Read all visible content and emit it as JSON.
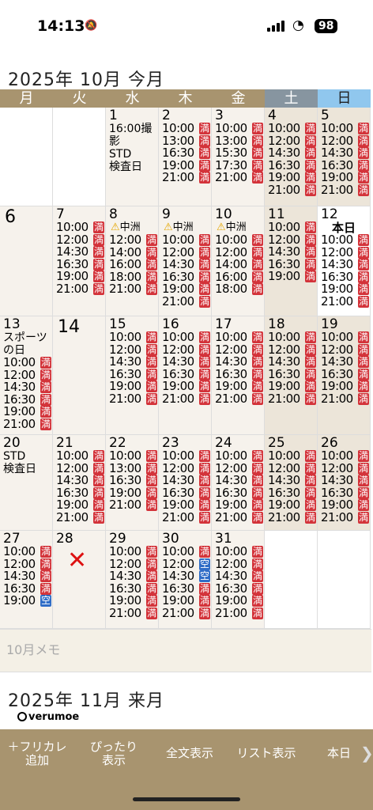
{
  "status": {
    "time": "14:13",
    "battery": "98"
  },
  "calendar": {
    "title": "2025年 10月 今月",
    "weekdays": [
      "月",
      "火",
      "水",
      "木",
      "金",
      "土",
      "日"
    ],
    "today_label": "本日",
    "full": "満",
    "empty": "空",
    "memo_placeholder": "10月メモ",
    "next_title": "2025年 11月 来月",
    "weeks": [
      [
        {
          "type": "empty"
        },
        {
          "type": "empty"
        },
        {
          "day": "1",
          "notes": [
            "16:00撮",
            "影",
            "STD",
            "検査日"
          ],
          "slots": []
        },
        {
          "day": "2",
          "slots": [
            [
              "10:00",
              "満"
            ],
            [
              "13:00",
              "満"
            ],
            [
              "16:30",
              "満"
            ],
            [
              "19:00",
              "満"
            ],
            [
              "21:00",
              "満"
            ]
          ]
        },
        {
          "day": "3",
          "slots": [
            [
              "10:00",
              "満"
            ],
            [
              "13:00",
              "満"
            ],
            [
              "15:30",
              "満"
            ],
            [
              "17:30",
              "満"
            ],
            [
              "21:00",
              "満"
            ]
          ]
        },
        {
          "day": "4",
          "wk": true,
          "slots": [
            [
              "10:00",
              "満"
            ],
            [
              "12:00",
              "満"
            ],
            [
              "14:30",
              "満"
            ],
            [
              "16:30",
              "満"
            ],
            [
              "19:00",
              "満"
            ],
            [
              "21:00",
              "満"
            ]
          ]
        },
        {
          "day": "5",
          "wk": true,
          "slots": [
            [
              "10:00",
              "満"
            ],
            [
              "12:00",
              "満"
            ],
            [
              "14:30",
              "満"
            ],
            [
              "16:30",
              "満"
            ],
            [
              "19:00",
              "満"
            ],
            [
              "21:00",
              "満"
            ]
          ]
        }
      ],
      [
        {
          "day": "6",
          "big": true,
          "slots": []
        },
        {
          "day": "7",
          "slots": [
            [
              "10:00",
              "満"
            ],
            [
              "12:00",
              "満"
            ],
            [
              "14:30",
              "満"
            ],
            [
              "16:30",
              "満"
            ],
            [
              "19:00",
              "満"
            ],
            [
              "21:00",
              "満"
            ]
          ]
        },
        {
          "day": "8",
          "warn": "中洲",
          "slots": [
            [
              "12:00",
              "満"
            ],
            [
              "14:00",
              "満"
            ],
            [
              "16:00",
              "満"
            ],
            [
              "18:00",
              "満"
            ],
            [
              "21:00",
              "満"
            ]
          ]
        },
        {
          "day": "9",
          "warn": "中洲",
          "slots": [
            [
              "10:00",
              "満"
            ],
            [
              "12:00",
              "満"
            ],
            [
              "14:30",
              "満"
            ],
            [
              "16:30",
              "満"
            ],
            [
              "19:00",
              "満"
            ],
            [
              "21:00",
              "満"
            ]
          ]
        },
        {
          "day": "10",
          "warn": "中洲",
          "slots": [
            [
              "10:00",
              "満"
            ],
            [
              "12:00",
              "満"
            ],
            [
              "14:00",
              "満"
            ],
            [
              "16:00",
              "満"
            ],
            [
              "18:00",
              "満"
            ]
          ]
        },
        {
          "day": "11",
          "wk": true,
          "slots": [
            [
              "10:00",
              "満"
            ],
            [
              "12:00",
              "満"
            ],
            [
              "14:30",
              "満"
            ],
            [
              "16:30",
              "満"
            ],
            [
              "19:00",
              "満"
            ]
          ]
        },
        {
          "day": "12",
          "today": true,
          "slots": [
            [
              "10:00",
              "満"
            ],
            [
              "12:00",
              "満"
            ],
            [
              "14:30",
              "満"
            ],
            [
              "16:30",
              "満"
            ],
            [
              "19:00",
              "満"
            ],
            [
              "21:00",
              "満"
            ]
          ]
        }
      ],
      [
        {
          "day": "13",
          "notes": [
            "スポーツ",
            "の日"
          ],
          "slots": [
            [
              "10:00",
              "満"
            ],
            [
              "12:00",
              "満"
            ],
            [
              "14:30",
              "満"
            ],
            [
              "16:30",
              "満"
            ],
            [
              "19:00",
              "満"
            ],
            [
              "21:00",
              "満"
            ]
          ]
        },
        {
          "day": "14",
          "big": true,
          "slots": []
        },
        {
          "day": "15",
          "slots": [
            [
              "10:00",
              "満"
            ],
            [
              "12:00",
              "満"
            ],
            [
              "14:30",
              "満"
            ],
            [
              "16:30",
              "満"
            ],
            [
              "19:00",
              "満"
            ],
            [
              "21:00",
              "満"
            ]
          ]
        },
        {
          "day": "16",
          "slots": [
            [
              "10:00",
              "満"
            ],
            [
              "12:00",
              "満"
            ],
            [
              "14:30",
              "満"
            ],
            [
              "16:30",
              "満"
            ],
            [
              "19:00",
              "満"
            ],
            [
              "21:00",
              "満"
            ]
          ]
        },
        {
          "day": "17",
          "slots": [
            [
              "10:00",
              "満"
            ],
            [
              "12:00",
              "満"
            ],
            [
              "14:30",
              "満"
            ],
            [
              "16:30",
              "満"
            ],
            [
              "19:00",
              "満"
            ],
            [
              "21:00",
              "満"
            ]
          ]
        },
        {
          "day": "18",
          "wk": true,
          "slots": [
            [
              "10:00",
              "満"
            ],
            [
              "12:00",
              "満"
            ],
            [
              "14:30",
              "満"
            ],
            [
              "16:30",
              "満"
            ],
            [
              "19:00",
              "満"
            ],
            [
              "21:00",
              "満"
            ]
          ]
        },
        {
          "day": "19",
          "wk": true,
          "slots": [
            [
              "10:00",
              "満"
            ],
            [
              "12:00",
              "満"
            ],
            [
              "14:30",
              "満"
            ],
            [
              "16:30",
              "満"
            ],
            [
              "19:00",
              "満"
            ],
            [
              "21:00",
              "満"
            ]
          ]
        }
      ],
      [
        {
          "day": "20",
          "notes": [
            "STD",
            "検査日"
          ],
          "slots": []
        },
        {
          "day": "21",
          "slots": [
            [
              "10:00",
              "満"
            ],
            [
              "12:00",
              "満"
            ],
            [
              "14:30",
              "満"
            ],
            [
              "16:30",
              "満"
            ],
            [
              "19:00",
              "満"
            ],
            [
              "21:00",
              "満"
            ]
          ]
        },
        {
          "day": "22",
          "slots": [
            [
              "10:00",
              "満"
            ],
            [
              "13:00",
              "満"
            ],
            [
              "16:30",
              "満"
            ],
            [
              "19:00",
              "満"
            ],
            [
              "21:00",
              "満"
            ]
          ]
        },
        {
          "day": "23",
          "slots": [
            [
              "10:00",
              "満"
            ],
            [
              "12:00",
              "満"
            ],
            [
              "14:30",
              "満"
            ],
            [
              "16:30",
              "満"
            ],
            [
              "19:00",
              "満"
            ],
            [
              "21:00",
              "満"
            ]
          ]
        },
        {
          "day": "24",
          "slots": [
            [
              "10:00",
              "満"
            ],
            [
              "12:00",
              "満"
            ],
            [
              "14:30",
              "満"
            ],
            [
              "16:30",
              "満"
            ],
            [
              "19:00",
              "満"
            ],
            [
              "21:00",
              "満"
            ]
          ]
        },
        {
          "day": "25",
          "wk": true,
          "slots": [
            [
              "10:00",
              "満"
            ],
            [
              "12:00",
              "満"
            ],
            [
              "14:30",
              "満"
            ],
            [
              "16:30",
              "満"
            ],
            [
              "19:00",
              "満"
            ],
            [
              "21:00",
              "満"
            ]
          ]
        },
        {
          "day": "26",
          "wk": true,
          "slots": [
            [
              "10:00",
              "満"
            ],
            [
              "12:00",
              "満"
            ],
            [
              "14:30",
              "満"
            ],
            [
              "16:30",
              "満"
            ],
            [
              "19:00",
              "満"
            ],
            [
              "21:00",
              "満"
            ]
          ]
        }
      ],
      [
        {
          "day": "27",
          "slots": [
            [
              "10:00",
              "満"
            ],
            [
              "12:00",
              "満"
            ],
            [
              "14:30",
              "満"
            ],
            [
              "16:30",
              "満"
            ],
            [
              "19:00",
              "空"
            ]
          ]
        },
        {
          "day": "28",
          "closed": true,
          "slots": []
        },
        {
          "day": "29",
          "slots": [
            [
              "10:00",
              "満"
            ],
            [
              "12:00",
              "満"
            ],
            [
              "14:30",
              "満"
            ],
            [
              "16:30",
              "満"
            ],
            [
              "19:00",
              "満"
            ],
            [
              "21:00",
              "満"
            ]
          ]
        },
        {
          "day": "30",
          "slots": [
            [
              "10:00",
              "満"
            ],
            [
              "12:00",
              "空"
            ],
            [
              "14:30",
              "空"
            ],
            [
              "16:30",
              "満"
            ],
            [
              "19:00",
              "満"
            ],
            [
              "21:00",
              "満"
            ]
          ]
        },
        {
          "day": "31",
          "slots": [
            [
              "10:00",
              "満"
            ],
            [
              "12:00",
              "満"
            ],
            [
              "14:30",
              "満"
            ],
            [
              "16:30",
              "満"
            ],
            [
              "19:00",
              "満"
            ],
            [
              "21:00",
              "満"
            ]
          ]
        },
        {
          "type": "empty"
        },
        {
          "type": "empty"
        }
      ]
    ]
  },
  "logo": "verumoe",
  "toolbar": {
    "add_line1": "＋フリカレ",
    "add_line2": "追加",
    "fit_line1": "ぴったり",
    "fit_line2": "表示",
    "full_view": "全文表示",
    "list_view": "リスト表示",
    "today": "本日"
  }
}
